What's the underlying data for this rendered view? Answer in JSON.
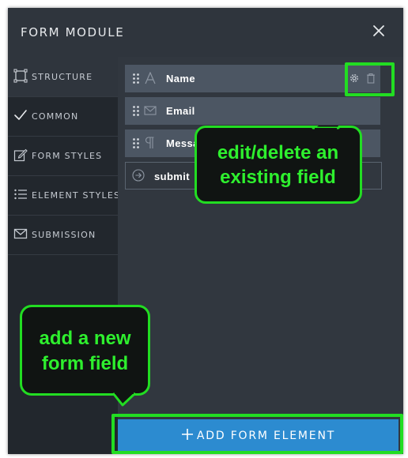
{
  "window": {
    "title": "FORM MODULE"
  },
  "sidebar": {
    "items": [
      {
        "label": "STRUCTURE",
        "icon": "frame-icon",
        "active": true
      },
      {
        "label": "COMMON",
        "icon": "check-icon",
        "active": false
      },
      {
        "label": "FORM STYLES",
        "icon": "edit-icon",
        "active": false
      },
      {
        "label": "ELEMENT STYLES",
        "icon": "list-icon",
        "active": false
      },
      {
        "label": "SUBMISSION",
        "icon": "envelope-icon",
        "active": false
      }
    ]
  },
  "fields": [
    {
      "label": "Name",
      "icon": "text-icon"
    },
    {
      "label": "Email",
      "icon": "envelope-icon"
    },
    {
      "label": "Message",
      "icon": "paragraph-icon"
    },
    {
      "label": "submit",
      "icon": "arrow-circle-icon"
    }
  ],
  "footer": {
    "add_label": "ADD FORM ELEMENT"
  },
  "annotations": {
    "edit_delete": [
      "edit/delete an",
      "existing field"
    ],
    "add_new": [
      "add a new",
      "form field"
    ]
  },
  "colors": {
    "panel": "#2f353d",
    "sidebar": "#22272d",
    "field_row": "#4c5663",
    "accent_blue": "#2c8bd0",
    "highlight_green": "#22dd22"
  }
}
